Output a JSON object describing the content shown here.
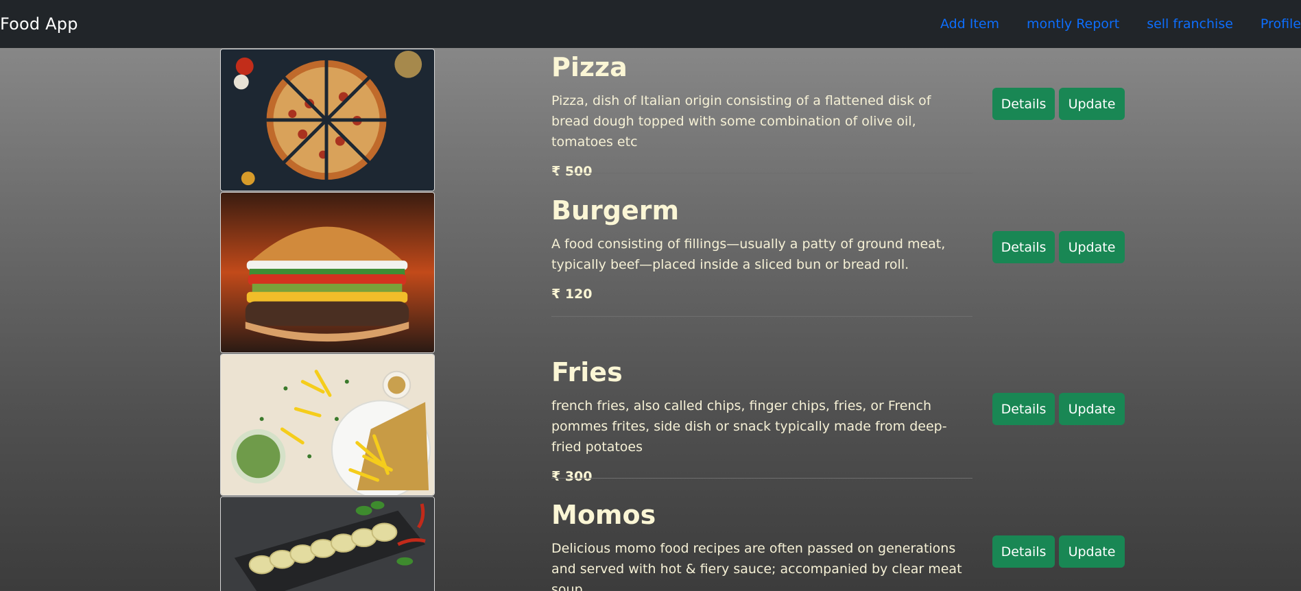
{
  "navbar": {
    "brand": "Food App",
    "links": [
      "Add Item",
      "montly Report",
      "sell franchise",
      "Profile"
    ]
  },
  "items": [
    {
      "title": "Pizza",
      "description": "Pizza, dish of Italian origin consisting of a flattened disk of bread dough topped with some combination of olive oil, tomatoes etc",
      "price": "₹ 500",
      "details_label": "Details",
      "update_label": "Update",
      "image": "pizza-photo"
    },
    {
      "title": "Burgerm",
      "description": "A food consisting of fillings—usually a patty of ground meat, typically beef—placed inside a sliced bun or bread roll.",
      "price": "₹ 120",
      "details_label": "Details",
      "update_label": "Update",
      "image": "burger-photo"
    },
    {
      "title": "Fries",
      "description": "french fries, also called chips, finger chips, fries, or French pommes frites, side dish or snack typically made from deep-fried potatoes",
      "price": "₹ 300",
      "details_label": "Details",
      "update_label": "Update",
      "image": "fries-photo"
    },
    {
      "title": "Momos",
      "description": "Delicious momo food recipes are often passed on generations and served with hot & fiery sauce; accompanied by clear meat soup",
      "details_label": "Details",
      "update_label": "Update",
      "image": "momos-photo"
    }
  ],
  "colors": {
    "navbar_bg": "#212529",
    "link": "#0d6efd",
    "button": "#198754",
    "title_text": "#fbf6d5"
  }
}
